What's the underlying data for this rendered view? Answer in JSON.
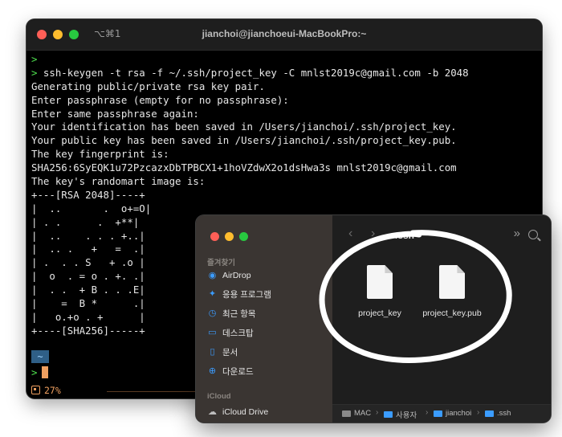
{
  "terminal": {
    "shortcut": "⌥⌘1",
    "title": "jianchoi@jianchoeui-MacBookPro:~",
    "lines": [
      {
        "prompt": ">",
        "text": ""
      },
      {
        "prompt": ">",
        "text": " ssh-keygen -t rsa -f ~/.ssh/project_key -C mnlst2019c@gmail.com -b 2048"
      },
      {
        "prompt": "",
        "text": "Generating public/private rsa key pair."
      },
      {
        "prompt": "",
        "text": "Enter passphrase (empty for no passphrase):"
      },
      {
        "prompt": "",
        "text": "Enter same passphrase again:"
      },
      {
        "prompt": "",
        "text": "Your identification has been saved in /Users/jianchoi/.ssh/project_key."
      },
      {
        "prompt": "",
        "text": "Your public key has been saved in /Users/jianchoi/.ssh/project_key.pub."
      },
      {
        "prompt": "",
        "text": "The key fingerprint is:"
      },
      {
        "prompt": "",
        "text": "SHA256:6SyEQK1u72PzcazxDbTPBCX1+1hoVZdwX2o1dsHwa3s mnlst2019c@gmail.com"
      },
      {
        "prompt": "",
        "text": "The key's randomart image is:"
      },
      {
        "prompt": "",
        "text": "+---[RSA 2048]----+"
      },
      {
        "prompt": "",
        "text": "|  ..       .  o+=O|"
      },
      {
        "prompt": "",
        "text": "| . .      .  +**|"
      },
      {
        "prompt": "",
        "text": "|  ..    . . . +..|"
      },
      {
        "prompt": "",
        "text": "|  .. .   +   =  .|"
      },
      {
        "prompt": "",
        "text": "| .  . . S   + .o |"
      },
      {
        "prompt": "",
        "text": "|  o  . = o . +. .|"
      },
      {
        "prompt": "",
        "text": "|  . .  + B . . .E|"
      },
      {
        "prompt": "",
        "text": "|    =  B *      .|"
      },
      {
        "prompt": "",
        "text": "|   o.+o . +      |"
      },
      {
        "prompt": "",
        "text": "+----[SHA256]-----+"
      }
    ],
    "dir_badge": "~",
    "prompt2": ">",
    "status": "27%"
  },
  "finder": {
    "sidebar": {
      "favorites_label": "즐겨찾기",
      "items": [
        {
          "label": "AirDrop",
          "icon": "airdrop-icon",
          "glyph": "◉"
        },
        {
          "label": "응용 프로그램",
          "icon": "applications-icon",
          "glyph": "✦"
        },
        {
          "label": "최근 항목",
          "icon": "recents-icon",
          "glyph": "◷"
        },
        {
          "label": "데스크탑",
          "icon": "desktop-icon",
          "glyph": "▭"
        },
        {
          "label": "문서",
          "icon": "documents-icon",
          "glyph": "▯"
        },
        {
          "label": "다운로드",
          "icon": "downloads-icon",
          "glyph": "⊕"
        }
      ],
      "icloud_label": "iCloud",
      "icloud_item": {
        "label": "iCloud Drive",
        "icon": "icloud-icon",
        "glyph": "☁"
      }
    },
    "toolbar": {
      "back": "‹",
      "forward": "›",
      "title": ".ssh",
      "more": "»"
    },
    "files": [
      {
        "name": "project_key"
      },
      {
        "name": "project_key.pub"
      }
    ],
    "pathbar": [
      {
        "label": "MAC",
        "color": "#8a8a8a"
      },
      {
        "label": "사용자",
        "color": "#3b9cff"
      },
      {
        "label": "jianchoi",
        "color": "#3b9cff"
      },
      {
        "label": ".ssh",
        "color": "#3b9cff"
      }
    ],
    "pathbar_sep": "›"
  },
  "colors": {
    "prompt_green": "#4ee04e",
    "accent_blue": "#3b9cff",
    "cursor_orange": "#f0a060"
  }
}
